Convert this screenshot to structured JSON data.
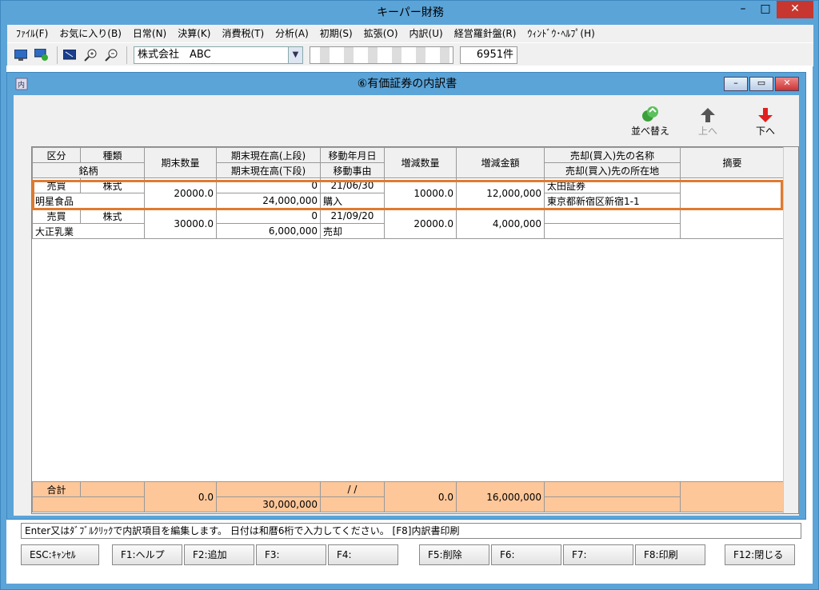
{
  "app": {
    "title": "キーパー財務"
  },
  "menu": [
    "ﾌｧｲﾙ(F)",
    "お気に入り(B)",
    "日常(N)",
    "決算(K)",
    "消費税(T)",
    "分析(A)",
    "初期(S)",
    "拡張(O)",
    "内訳(U)",
    "経営羅針盤(R)",
    "ｳｨﾝﾄﾞｳ･ﾍﾙﾌﾟ(H)"
  ],
  "toolbar": {
    "company": "株式会社　ABC",
    "count": "6951件"
  },
  "window": {
    "title": "⑥有価証券の内訳書"
  },
  "actions": {
    "sort": "並べ替え",
    "up": "上へ",
    "down": "下へ"
  },
  "headers": {
    "kubun": "区分",
    "shurui": "種類",
    "meigara": "銘柄",
    "qty": "期末数量",
    "amt_top": "期末現在高(上段)",
    "amt_bottom": "期末現在高(下段)",
    "date": "移動年月日",
    "reason": "移動事由",
    "chg_qty": "増減数量",
    "chg_amt": "増減金額",
    "party_name": "売却(買入)先の名称",
    "party_addr": "売却(買入)先の所在地",
    "note": "摘要"
  },
  "rows": [
    {
      "kubun": "売買",
      "shurui": "株式",
      "meigara": "明星食品",
      "qty": "20000.0",
      "amt_top": "0",
      "amt_bottom": "24,000,000",
      "date": "21/06/30",
      "reason": "購入",
      "chg_qty": "10000.0",
      "chg_amt": "12,000,000",
      "party_name": "太田証券",
      "party_addr": "東京都新宿区新宿1-1",
      "note": ""
    },
    {
      "kubun": "売買",
      "shurui": "株式",
      "meigara": "大正乳業",
      "qty": "30000.0",
      "amt_top": "0",
      "amt_bottom": "6,000,000",
      "date": "21/09/20",
      "reason": "売却",
      "chg_qty": "20000.0",
      "chg_amt": "4,000,000",
      "party_name": "",
      "party_addr": "",
      "note": ""
    }
  ],
  "totals": {
    "label": "合計",
    "qty": "0.0",
    "amt_bottom": "30,000,000",
    "date": "/ /",
    "chg_qty": "0.0",
    "chg_amt": "16,000,000"
  },
  "status": "Enter又はﾀﾞﾌﾞﾙｸﾘｯｸで内訳項目を編集します。 日付は和暦6桁で入力してください。 [F8]内訳書印刷",
  "fkeys": [
    "ESC:ｷｬﾝｾﾙ",
    "F1:ヘルプ",
    "F2:追加",
    "F3:",
    "F4:",
    "F5:削除",
    "F6:",
    "F7:",
    "F8:印刷",
    "F12:閉じる"
  ]
}
